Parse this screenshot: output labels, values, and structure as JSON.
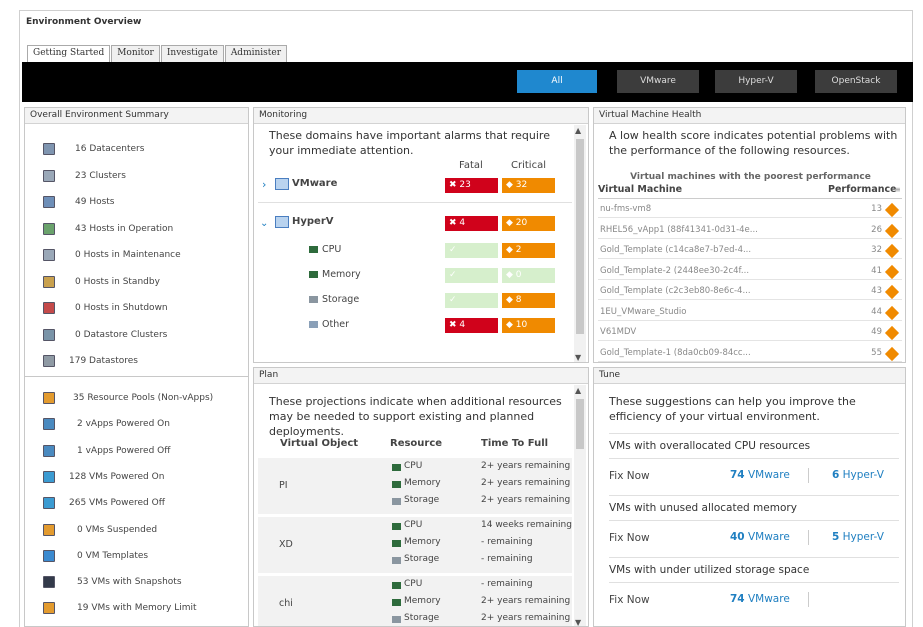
{
  "page_title": "Environment Overview",
  "tabs": [
    "Getting Started",
    "Monitor",
    "Investigate",
    "Administer"
  ],
  "filters": [
    "All",
    "VMware",
    "Hyper-V",
    "OpenStack"
  ],
  "summary": {
    "title": "Overall Environment Summary",
    "group1": [
      {
        "icon": "datacenter-icon",
        "text": "16 Datacenters"
      },
      {
        "icon": "cluster-icon",
        "text": "23 Clusters"
      },
      {
        "icon": "host-icon",
        "text": "49 Hosts"
      },
      {
        "icon": "host-operation-icon",
        "text": "43 Hosts in Operation"
      },
      {
        "icon": "host-maintenance-icon",
        "text": "0 Hosts in Maintenance"
      },
      {
        "icon": "host-standby-icon",
        "text": "0 Hosts in Standby"
      },
      {
        "icon": "host-shutdown-icon",
        "text": "0 Hosts in Shutdown"
      },
      {
        "icon": "datastore-cluster-icon",
        "text": "0 Datastore Clusters"
      },
      {
        "icon": "datastore-icon",
        "text": "179 Datastores"
      }
    ],
    "group2": [
      {
        "icon": "resource-pool-icon",
        "text": "35 Resource Pools (Non-vApps)"
      },
      {
        "icon": "vapp-on-icon",
        "text": "2 vApps Powered On"
      },
      {
        "icon": "vapp-off-icon",
        "text": "1 vApps Powered Off"
      },
      {
        "icon": "vm-on-icon",
        "text": "128 VMs Powered On"
      },
      {
        "icon": "vm-off-icon",
        "text": "265 VMs Powered Off"
      },
      {
        "icon": "vm-suspended-icon",
        "text": "0 VMs Suspended"
      },
      {
        "icon": "vm-template-icon",
        "text": "0 VM Templates"
      },
      {
        "icon": "vm-snapshot-icon",
        "text": "53 VMs with Snapshots"
      },
      {
        "icon": "vm-memory-limit-icon",
        "text": "19 VMs with Memory Limit"
      }
    ]
  },
  "monitoring": {
    "title": "Monitoring",
    "description": "These domains have important alarms that require your immediate attention.",
    "col_fatal": "Fatal",
    "col_critical": "Critical",
    "vmware": {
      "label": "VMware",
      "fatal": "23",
      "critical": "32"
    },
    "hyperv": {
      "label": "HyperV",
      "fatal": "4",
      "critical": "20"
    },
    "rows": [
      {
        "label": "CPU",
        "fatal": "",
        "critical": "2"
      },
      {
        "label": "Memory",
        "fatal": "",
        "critical": "0"
      },
      {
        "label": "Storage",
        "fatal": "",
        "critical": "8"
      },
      {
        "label": "Other",
        "fatal": "4",
        "critical": "10"
      }
    ]
  },
  "vm_health": {
    "title": "Virtual Machine Health",
    "description": "A low health score indicates potential problems with the performance of the following resources.",
    "table_title": "Virtual machines with the poorest performance",
    "col_vm": "Virtual Machine",
    "col_perf": "Performance",
    "rows": [
      {
        "name": "nu-fms-vm8",
        "score": "13"
      },
      {
        "name": "RHEL56_vApp1 (88f41341-0d31-4e...",
        "score": "26"
      },
      {
        "name": "Gold_Template (c14ca8e7-b7ed-4...",
        "score": "32"
      },
      {
        "name": "Gold_Template-2 (2448ee30-2c4f...",
        "score": "41"
      },
      {
        "name": "Gold_Template (c2c3eb80-8e6c-4...",
        "score": "43"
      },
      {
        "name": "1EU_VMware_Studio",
        "score": "44"
      },
      {
        "name": "V61MDV",
        "score": "49"
      },
      {
        "name": "Gold_Template-1 (8da0cb09-84cc...",
        "score": "55"
      }
    ]
  },
  "plan": {
    "title": "Plan",
    "description": "These projections indicate when additional resources may be needed to support existing and planned deployments.",
    "col_object": "Virtual Object",
    "col_resource": "Resource",
    "col_time": "Time To Full",
    "groups": [
      {
        "name": "PI",
        "rows": [
          {
            "res": "CPU",
            "time": "2+ years remaining"
          },
          {
            "res": "Memory",
            "time": "2+ years remaining"
          },
          {
            "res": "Storage",
            "time": "2+ years remaining"
          }
        ]
      },
      {
        "name": "XD",
        "rows": [
          {
            "res": "CPU",
            "time": "14 weeks remaining"
          },
          {
            "res": "Memory",
            "time": "- remaining"
          },
          {
            "res": "Storage",
            "time": "- remaining"
          }
        ]
      },
      {
        "name": "chi",
        "rows": [
          {
            "res": "CPU",
            "time": "- remaining"
          },
          {
            "res": "Memory",
            "time": "2+ years remaining"
          },
          {
            "res": "Storage",
            "time": "2+ years remaining"
          }
        ]
      }
    ]
  },
  "tune": {
    "title": "Tune",
    "description": "These suggestions can help you improve the efficiency of your virtual environment.",
    "sections": [
      {
        "title": "VMs with overallocated CPU resources",
        "fix": "Fix Now",
        "vmware": "74",
        "vmware_label": "VMware",
        "hyperv": "6",
        "hyperv_label": "Hyper-V"
      },
      {
        "title": "VMs with unused allocated memory",
        "fix": "Fix Now",
        "vmware": "40",
        "vmware_label": "VMware",
        "hyperv": "5",
        "hyperv_label": "Hyper-V"
      },
      {
        "title": "VMs with under utilized storage space",
        "fix": "Fix Now",
        "vmware": "74",
        "vmware_label": "VMware",
        "hyperv": "",
        "hyperv_label": ""
      }
    ]
  },
  "colors": {
    "accent": "#1f88cf",
    "fatal": "#d0021b",
    "critical": "#f08a00",
    "ok": "#d6efcc"
  }
}
